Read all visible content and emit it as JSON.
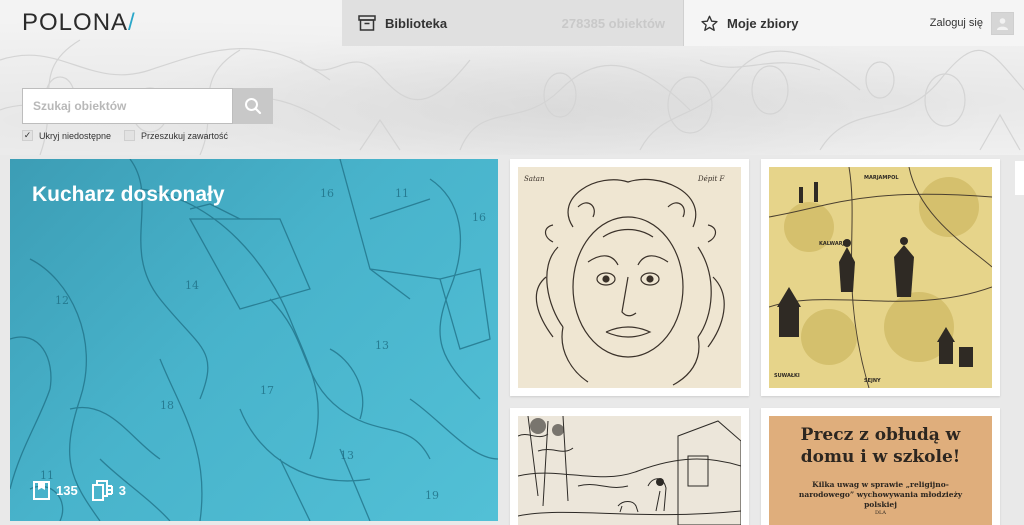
{
  "header": {
    "logo": "POLONA",
    "logo_slash": "/",
    "library_tab": {
      "label": "Biblioteka",
      "count": "278385 obiektów",
      "icon": "archive-box-icon"
    },
    "collections_tab": {
      "label": "Moje zbiory",
      "icon": "star-icon"
    },
    "login_label": "Zaloguj się"
  },
  "search": {
    "placeholder": "Szukaj obiektów",
    "value": "",
    "hide_unavailable": {
      "label": "Ukryj niedostępne",
      "checked": true
    },
    "search_content": {
      "label": "Przeszukuj zawartość",
      "checked": false
    }
  },
  "featured": {
    "title": "Kucharz doskonały",
    "objects_count": "135",
    "collections_count": "3"
  },
  "cards": [
    {
      "caption_left": "Satan",
      "caption_right": "Dépit F"
    },
    {
      "map_labels": [
        "MARJAMPOL",
        "KALWARJA",
        "SUWAŁKI",
        "SEJNY"
      ]
    },
    {
      "subject": "woodcut-landscape"
    },
    {
      "title": "Precz z obłudą w domu i w szkole!",
      "subtitle": "Kilka uwag w sprawie „religijno-narodowego” wychowywania młodzieży polskiej",
      "footer": "DLA"
    }
  ],
  "colors": {
    "accent": "#2aa7c9",
    "featured_overlay": "#4ab4cc"
  }
}
